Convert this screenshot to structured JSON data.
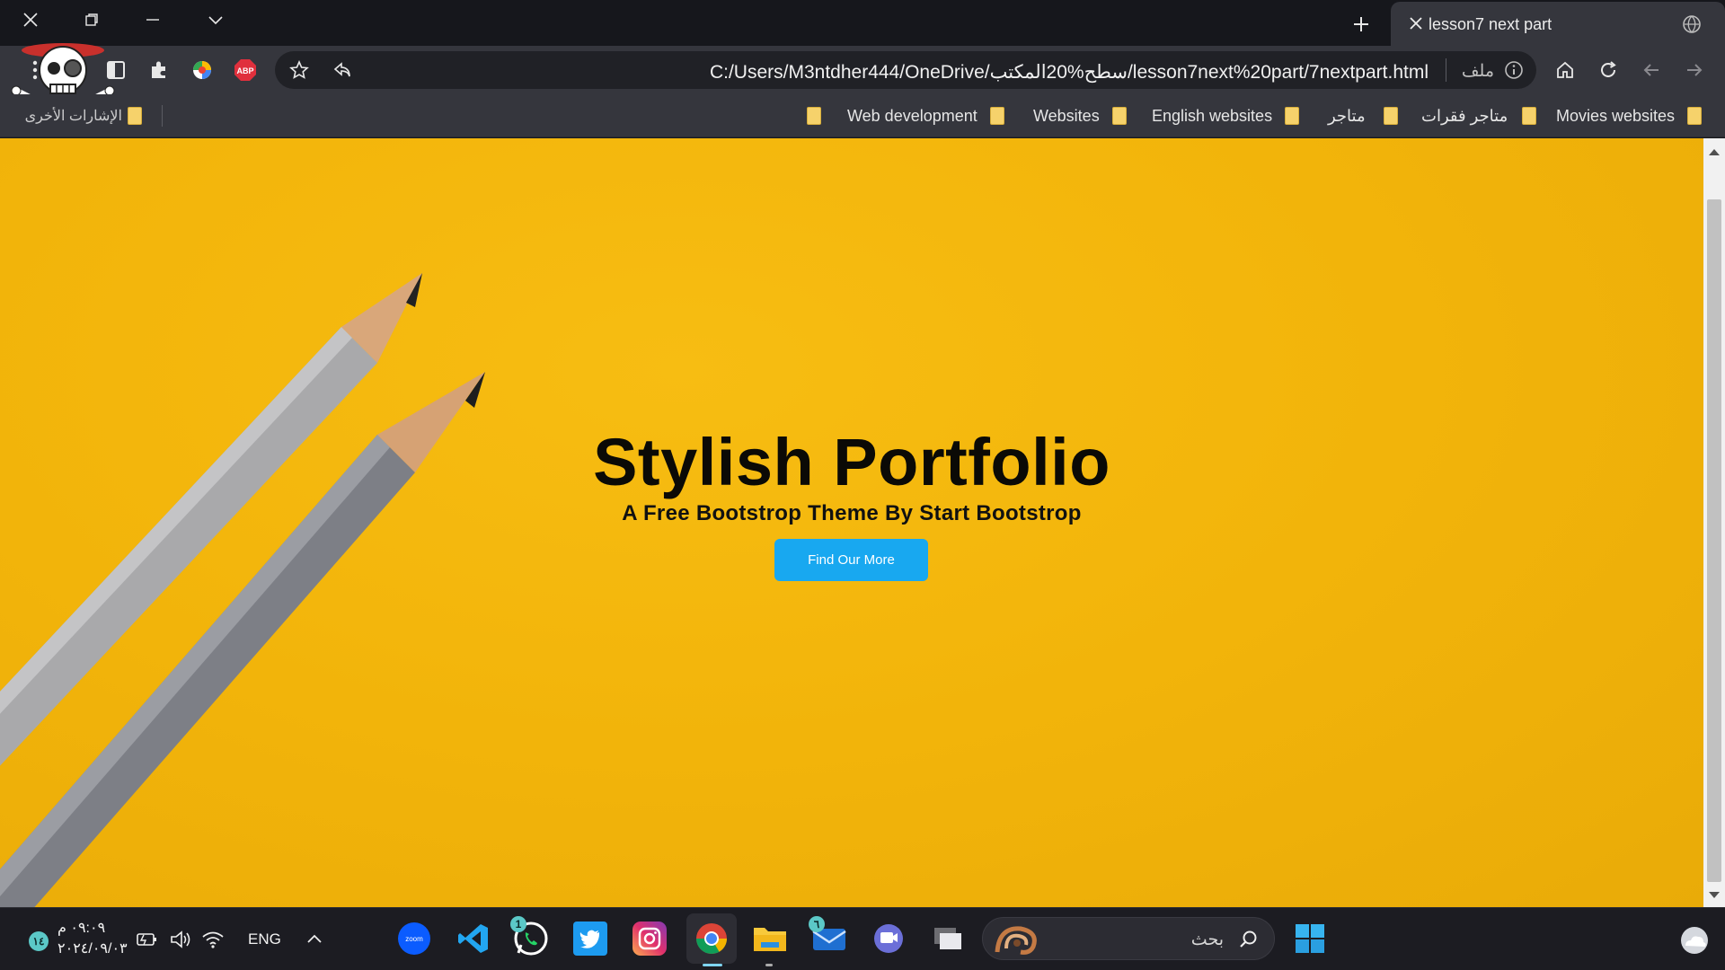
{
  "browser": {
    "tab_title": "lesson7 next part",
    "url": "C:/Users/M3ntdher444/OneDrive/سطح%20المكتب/lesson7next%20part/7nextpart.html",
    "url_scheme_label": "ملف",
    "bookmarks": [
      {
        "label": "Movies websites"
      },
      {
        "label": "متاجر فقرات"
      },
      {
        "label": "متاجر"
      },
      {
        "label": "English websites"
      },
      {
        "label": "Websites"
      },
      {
        "label": "Web development"
      }
    ],
    "other_bookmarks_label": "الإشارات الأخرى"
  },
  "page": {
    "title": "Stylish Portfolio",
    "subtitle": "A Free Bootstrop Theme By Start Bootstrop",
    "cta_label": "Find Our More",
    "bg_color": "#f3b60c",
    "cta_color": "#18a8f0"
  },
  "taskbar": {
    "search_placeholder": "بحث",
    "language": "ENG",
    "time": "٠٩:٠٩ م",
    "date": "٢٠٢٤/٠٩/٠٣",
    "notification_count": "١٤",
    "whatsapp_badge": "1",
    "mail_badge": "٦",
    "apps": [
      "zoom-icon",
      "vscode-icon",
      "whatsapp-icon",
      "twitter-icon",
      "instagram-icon",
      "chrome-icon",
      "file-explorer-icon",
      "mail-icon",
      "teams-icon",
      "task-view-icon"
    ]
  }
}
